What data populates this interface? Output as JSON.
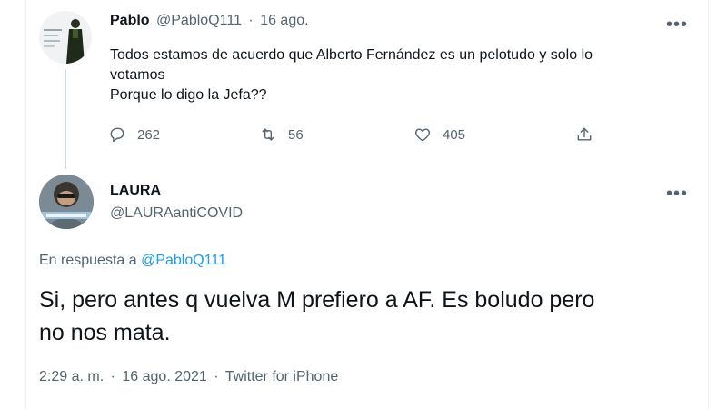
{
  "tweet1": {
    "author_name": "Pablo",
    "handle": "@PabloQ111",
    "separator": "·",
    "date": "16 ago.",
    "more_icon": "more-horizontal-icon",
    "text_lines": [
      "Todos estamos de acuerdo que Alberto Fernández es un pelotudo y solo lo",
      "votamos",
      "Porque lo digo la Jefa??"
    ],
    "actions": {
      "replies": "262",
      "retweets": "56",
      "likes": "405"
    }
  },
  "tweet2": {
    "author_name": "LAURA",
    "handle": "@LAURAantiCOVID",
    "more_icon": "more-horizontal-icon",
    "reply_prefix": "En respuesta a",
    "reply_handle": "@PabloQ111",
    "text_lines": [
      "Si, pero antes q vuelva M prefiero a AF. Es boludo pero",
      "no nos mata."
    ],
    "meta": {
      "time": "2:29 a. m.",
      "date": "16 ago. 2021",
      "source": "Twitter for iPhone",
      "separator": "·"
    }
  },
  "colors": {
    "text": "#0f1419",
    "muted": "#536471",
    "link": "#1d9bf0",
    "thread_line": "#cfd9de"
  }
}
